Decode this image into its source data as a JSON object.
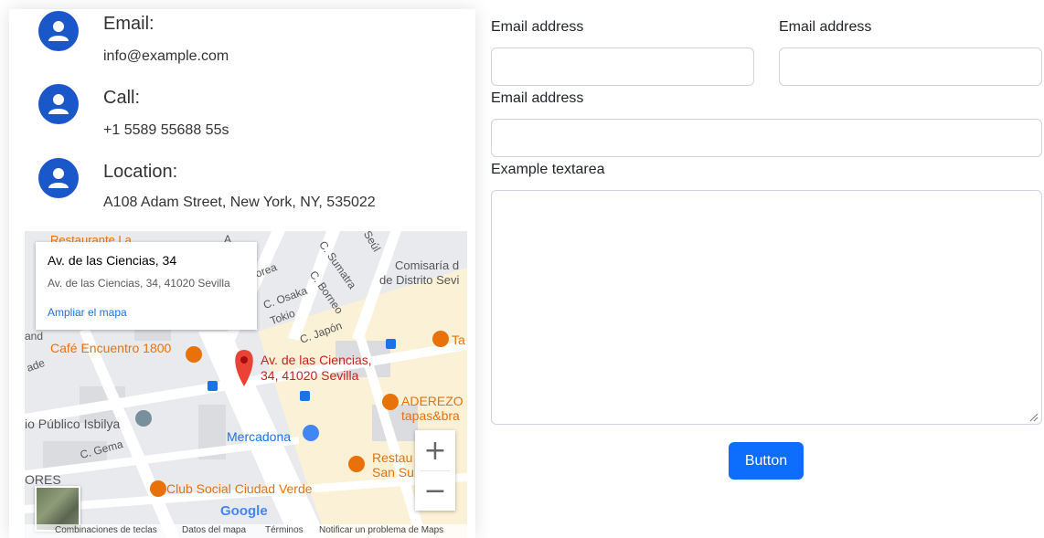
{
  "contact": {
    "email": {
      "title": "Email:",
      "value": "info@example.com",
      "icon": "person-icon"
    },
    "call": {
      "title": "Call:",
      "value": "+1 5589 55688 55s",
      "icon": "person-icon"
    },
    "location": {
      "title": "Location:",
      "value": "A108 Adam Street, New York, NY, 535022",
      "icon": "person-icon"
    }
  },
  "map": {
    "popup": {
      "title": "Av. de las Ciencias, 34",
      "address": "Av. de las Ciencias, 34, 41020 Sevilla",
      "link": "Ampliar el mapa"
    },
    "labels": {
      "restaurant_top": "Restaurante La",
      "comisaria_1": "Comisaría d",
      "comisaria_2": "de Distrito Sevi",
      "cafe": "Café Encuentro 1800",
      "pin_1": "Av. de las Ciencias,",
      "pin_2": "34, 41020 Sevilla",
      "aderezo_1": "ADEREZO",
      "aderezo_2": "tapas&bra",
      "publico": "io Público Isbilya",
      "mercadona": "Mercadona",
      "restau_1": "Restau",
      "restau_2": "San Su",
      "club": "Club Social Ciudad Verde",
      "ores": "ORES",
      "t_label": "Ta",
      "st_corea": "orea",
      "st_sumatra": "C. Sumatra",
      "st_borneo": "C. Borneo",
      "st_osaka": "C. Osaka",
      "st_tokio": "Tokio",
      "st_japon": "C. Japón",
      "st_seul": "Seúl",
      "st_gema": "C. Gema",
      "st_ade": "ade",
      "st_and": "and",
      "st_a": "A"
    },
    "zoom_in": "+",
    "zoom_out": "−",
    "google": "Google",
    "attribution": {
      "shortcuts": "Combinaciones de teclas",
      "data": "Datos del mapa",
      "terms": "Términos",
      "report": "Notificar un problema de Maps"
    }
  },
  "form": {
    "label1": "Email address",
    "label2": "Email address",
    "label3": "Email address",
    "textarea_label": "Example textarea",
    "button": "Button"
  },
  "colors": {
    "icon_bg": "#1a57c9",
    "button_bg": "#0d6efd",
    "link": "#1a73e8",
    "pin": "#ea4335",
    "poi_orange": "#e8710a"
  }
}
